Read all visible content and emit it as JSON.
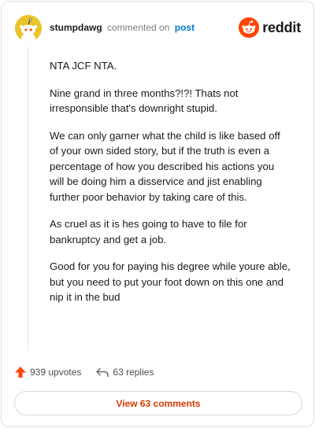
{
  "comment": {
    "username": "stumpdawg",
    "verb": "commented on",
    "target": "post",
    "paragraphs": [
      "NTA JCF NTA.",
      "Nine grand in three months?!?! Thats not irresponsible that's downright stupid.",
      "We can only garner what the child is like based off of your own sided story, but if the truth is even a percentage of how you described his actions you will be doing him a disservice and jist enabling further poor behavior by taking care of this.",
      "As cruel as it is hes going to have to file for bankruptcy and get a job.",
      "Good for you for paying his degree while youre able, but you need to put your foot down on this one and nip it in the bud"
    ],
    "upvotes": "939 upvotes",
    "replies": "63 replies"
  },
  "brand": {
    "wordmark": "reddit",
    "icon": "reddit-logo-icon",
    "color": "#ff4500"
  },
  "view_comments_label": "View 63 comments",
  "colors": {
    "upvote": "#ff4500",
    "avatar": "#e9c52c",
    "link": "#0079d3",
    "button_text": "#d93a00"
  }
}
